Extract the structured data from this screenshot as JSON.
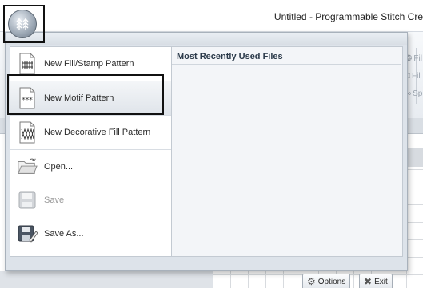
{
  "window": {
    "title": "Untitled - Programmable Stitch Cre"
  },
  "ribbon": {
    "right_items": [
      "Fil",
      "Fil",
      "Sp"
    ]
  },
  "app_menu": {
    "items": [
      {
        "label": "New Fill/Stamp Pattern",
        "icon": "fill-stamp-pattern-icon",
        "enabled": true
      },
      {
        "label": "New Motif Pattern",
        "icon": "motif-pattern-icon",
        "enabled": true,
        "selected": true
      },
      {
        "label": "New Decorative Fill Pattern",
        "icon": "decorative-fill-pattern-icon",
        "enabled": true
      },
      {
        "label": "Open...",
        "icon": "open-folder-icon",
        "enabled": true
      },
      {
        "label": "Save",
        "icon": "save-disk-icon",
        "enabled": false
      },
      {
        "label": "Save As...",
        "icon": "save-as-icon",
        "enabled": true
      }
    ],
    "mru_header": "Most Recently Used Files",
    "options_label": "Options",
    "exit_label": "Exit"
  }
}
